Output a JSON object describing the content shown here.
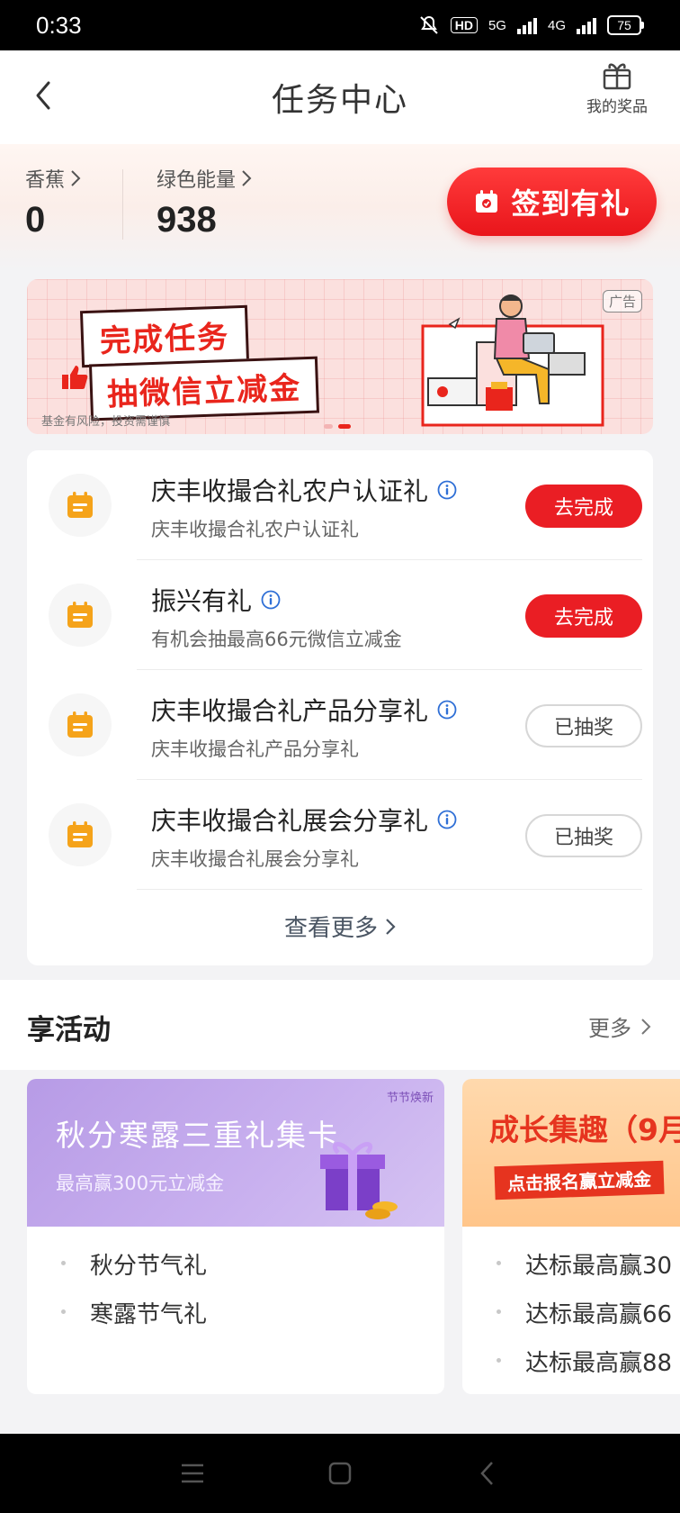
{
  "status_bar": {
    "time": "0:33",
    "hd": "HD",
    "net1": "5G",
    "net2": "4G",
    "battery": "75"
  },
  "header": {
    "title": "任务中心",
    "prize_label": "我的奖品"
  },
  "points": [
    {
      "label": "香蕉",
      "value": "0"
    },
    {
      "label": "绿色能量",
      "value": "938"
    }
  ],
  "checkin": {
    "label": "签到有礼"
  },
  "banner": {
    "ad_tag": "广告",
    "line1": "完成任务",
    "line2": "抽微信立减金",
    "disclaimer": "基金有风险，投资需谨慎"
  },
  "tasks": [
    {
      "title": "庆丰收撮合礼农户认证礼",
      "subtitle": "庆丰收撮合礼农户认证礼",
      "button": "去完成",
      "state": "primary"
    },
    {
      "title": "振兴有礼",
      "subtitle": "有机会抽最高66元微信立减金",
      "button": "去完成",
      "state": "primary"
    },
    {
      "title": "庆丰收撮合礼产品分享礼",
      "subtitle": "庆丰收撮合礼产品分享礼",
      "button": "已抽奖",
      "state": "done"
    },
    {
      "title": "庆丰收撮合礼展会分享礼",
      "subtitle": "庆丰收撮合礼展会分享礼",
      "button": "已抽奖",
      "state": "done"
    }
  ],
  "see_more": "查看更多",
  "activities": {
    "title": "享活动",
    "more": "更多",
    "cards": [
      {
        "banner_title": "秋分寒露三重礼集卡",
        "banner_sub": "最高赢300元立减金",
        "banner_tag": "节节焕新",
        "items": [
          "秋分节气礼",
          "寒露节气礼"
        ]
      },
      {
        "banner_title": "成长集趣（9月",
        "banner_sub": "点击报名赢立减金",
        "items": [
          "达标最高赢30",
          "达标最高赢66",
          "达标最高赢88"
        ]
      }
    ]
  },
  "colors": {
    "primary_red": "#ea1e24",
    "task_icon_orange": "#f5a31a",
    "background": "#f3f3f5"
  }
}
